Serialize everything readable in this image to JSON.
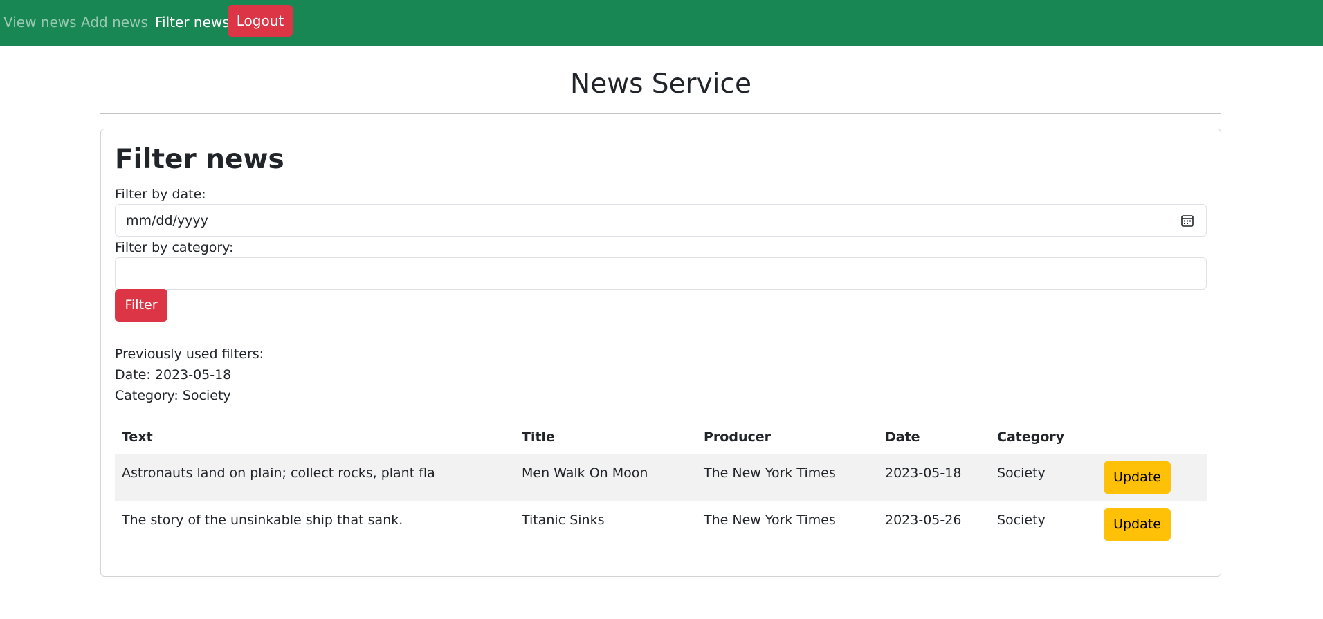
{
  "nav": {
    "items": [
      {
        "label": "View news",
        "state": "muted"
      },
      {
        "label": "Add news",
        "state": "muted"
      },
      {
        "label": "Filter news",
        "state": "active"
      }
    ],
    "logout_label": "Logout"
  },
  "page": {
    "title": "News Service"
  },
  "filter": {
    "heading": "Filter news",
    "date_label": "Filter by date:",
    "date_placeholder": "mm/dd/yyyy",
    "category_label": "Filter by category:",
    "category_value": "",
    "button_label": "Filter"
  },
  "previous_filters": {
    "heading": "Previously used filters:",
    "date_line": "Date: 2023-05-18",
    "category_line": "Category: Society"
  },
  "table": {
    "headers": [
      "Text",
      "Title",
      "Producer",
      "Date",
      "Category",
      ""
    ],
    "rows": [
      {
        "text": "Astronauts land on plain; collect rocks, plant fla",
        "title": "Men Walk On Moon",
        "producer": "The New York Times",
        "date": "2023-05-18",
        "category": "Society",
        "action": "Update"
      },
      {
        "text": "The story of the unsinkable ship that sank.",
        "title": "Titanic Sinks",
        "producer": "The New York Times",
        "date": "2023-05-26",
        "category": "Society",
        "action": "Update"
      }
    ]
  },
  "colors": {
    "navbar": "#198754",
    "danger": "#dc3545",
    "warning": "#ffc107",
    "row_stripe": "#f2f2f2"
  },
  "icons": {
    "date_picker": "calendar-icon"
  }
}
